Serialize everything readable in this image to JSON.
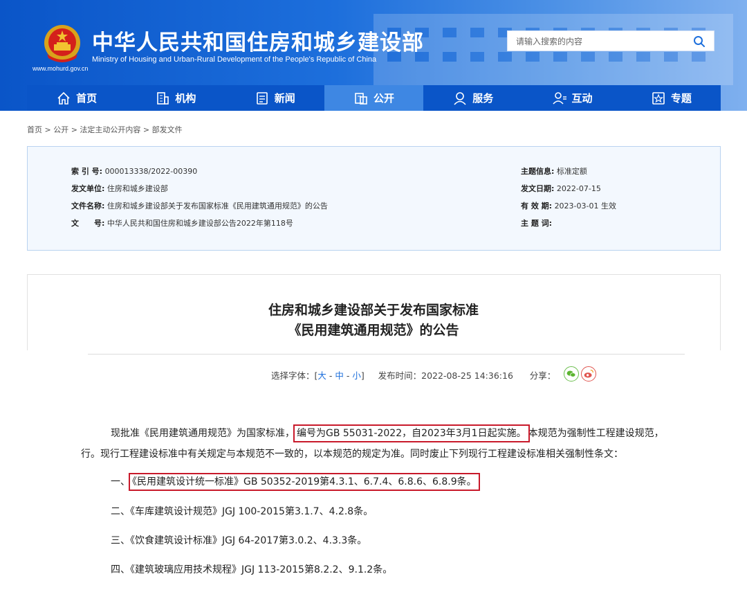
{
  "header": {
    "site_title": "中华人民共和国住房和城乡建设部",
    "site_subtitle": "Ministry of Housing and Urban-Rural Development of the People's Republic of China",
    "site_url": "www.mohurd.gov.cn",
    "search_placeholder": "请输入搜索的内容"
  },
  "nav": [
    {
      "label": "首页",
      "icon": "home-icon"
    },
    {
      "label": "机构",
      "icon": "building-icon"
    },
    {
      "label": "新闻",
      "icon": "news-icon"
    },
    {
      "label": "公开",
      "icon": "open-gov-icon",
      "active": true
    },
    {
      "label": "服务",
      "icon": "service-icon"
    },
    {
      "label": "互动",
      "icon": "interact-icon"
    },
    {
      "label": "专题",
      "icon": "topic-icon"
    }
  ],
  "breadcrumb": "首页 > 公开 > 法定主动公开内容 > 部发文件",
  "info": {
    "index_label": "索 引 号:",
    "index_value": "000013338/2022-00390",
    "issuer_label": "发文单位:",
    "issuer_value": "住房和城乡建设部",
    "docname_label": "文件名称:",
    "docname_value": "住房和城乡建设部关于发布国家标准《民用建筑通用规范》的公告",
    "docno_label": "文　　号:",
    "docno_value": "中华人民共和国住房和城乡建设部公告2022年第118号",
    "topic_label": "主题信息:",
    "topic_value": "标准定额",
    "date_label": "发文日期:",
    "date_value": "2022-07-15",
    "valid_label": "有 效 期:",
    "valid_value": "2023-03-01 生效",
    "keywords_label": "主 题 词:",
    "keywords_value": ""
  },
  "article": {
    "title_line1": "住房和城乡建设部关于发布国家标准",
    "title_line2": "《民用建筑通用规范》的公告",
    "font_label": "选择字体：[",
    "font_large": "大",
    "font_medium": "中",
    "font_small": "小",
    "font_close": "]",
    "publish_label": "发布时间：",
    "publish_time": "2022-08-25 14:36:16",
    "share_label": "分享：",
    "p1_a": "现批准《民用建筑通用规范》为国家标准，",
    "p1_hl": "编号为GB 55031-2022，自2023年3月1日起实施。",
    "p1_b": "本规范为强制性工程建设规范，",
    "p2": "行。现行工程建设标准中有关规定与本规范不一致的，以本规范的规定为准。同时废止下列现行工程建设标准相关强制性条文：",
    "item1_prefix": "一、",
    "item1": "《民用建筑设计统一标准》GB 50352-2019第4.3.1、6.7.4、6.8.6、6.8.9条。",
    "item2": "二、《车库建筑设计规范》JGJ 100-2015第3.1.7、4.2.8条。",
    "item3": "三、《饮食建筑设计标准》JGJ 64-2017第3.0.2、4.3.3条。",
    "item4": "四、《建筑玻璃应用技术规程》JGJ 113-2015第8.2.2、9.1.2条。"
  }
}
